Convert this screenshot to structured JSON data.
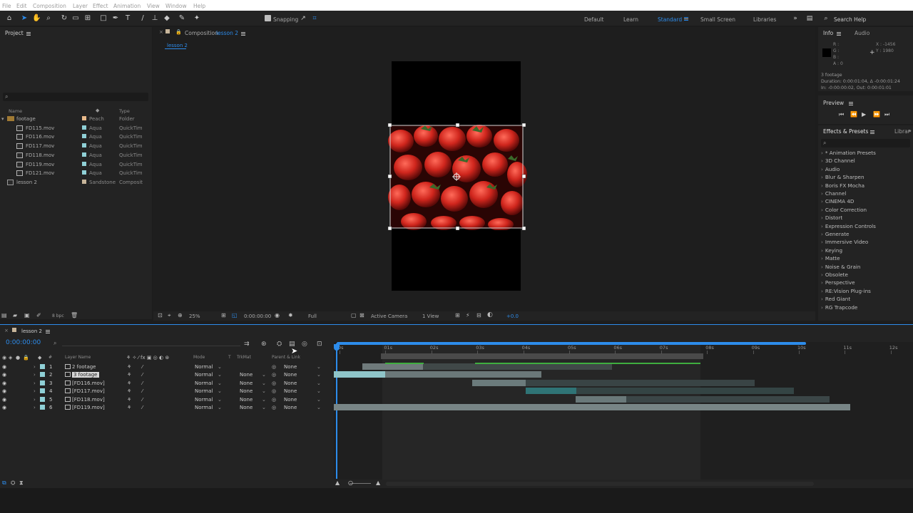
{
  "menu": [
    "File",
    "Edit",
    "Composition",
    "Layer",
    "Effect",
    "Animation",
    "View",
    "Window",
    "Help"
  ],
  "toolbar": {
    "snapping_label": "Snapping",
    "workspaces": [
      "Default",
      "Learn",
      "Standard",
      "Small Screen",
      "Libraries"
    ],
    "active_workspace": "Standard",
    "search_help": "Search Help"
  },
  "project": {
    "title": "Project",
    "col_name": "Name",
    "col_type": "Type",
    "items": [
      {
        "name": "footage",
        "label": "Peach",
        "type": "Folder",
        "color": "#e8b98a",
        "kind": "folder"
      },
      {
        "name": "FD115.mov",
        "label": "Aqua",
        "type": "QuickTim",
        "color": "#8fd0d6",
        "kind": "file"
      },
      {
        "name": "FD116.mov",
        "label": "Aqua",
        "type": "QuickTim",
        "color": "#8fd0d6",
        "kind": "file"
      },
      {
        "name": "FD117.mov",
        "label": "Aqua",
        "type": "QuickTim",
        "color": "#8fd0d6",
        "kind": "file"
      },
      {
        "name": "FD118.mov",
        "label": "Aqua",
        "type": "QuickTim",
        "color": "#8fd0d6",
        "kind": "file"
      },
      {
        "name": "FD119.mov",
        "label": "Aqua",
        "type": "QuickTim",
        "color": "#8fd0d6",
        "kind": "file"
      },
      {
        "name": "FD121.mov",
        "label": "Aqua",
        "type": "QuickTim",
        "color": "#8fd0d6",
        "kind": "file"
      },
      {
        "name": "lesson 2",
        "label": "Sandstone",
        "type": "Composit",
        "color": "#c7b59a",
        "kind": "comp"
      }
    ],
    "bpc": "8 bpc"
  },
  "composition": {
    "tab_prefix": "Composition",
    "tab_name": "lesson 2",
    "breadcrumb": "lesson 2",
    "zoom": "25%",
    "timecode": "0:00:00:00",
    "resolution": "Full",
    "camera": "Active Camera",
    "views": "1 View",
    "exposure": "+0.0"
  },
  "info": {
    "tab_info": "Info",
    "tab_audio": "Audio",
    "rgba": [
      "R :",
      "G :",
      "B :",
      "A : 0"
    ],
    "x": "X : -1456",
    "y": "Y : 1980",
    "sel_name": "3 footage",
    "duration": "Duration: 0:00:01:04, Δ -0:00:01:24",
    "inout": "In: -0:00:00:02, Out: 0:00:01:01"
  },
  "preview": {
    "title": "Preview"
  },
  "effects": {
    "tab": "Effects & Presets",
    "tab2": "Librar",
    "items": [
      "* Animation Presets",
      "3D Channel",
      "Audio",
      "Blur & Sharpen",
      "Boris FX Mocha",
      "Channel",
      "CINEMA 4D",
      "Color Correction",
      "Distort",
      "Expression Controls",
      "Generate",
      "Immersive Video",
      "Keying",
      "Matte",
      "Noise & Grain",
      "Obsolete",
      "Perspective",
      "RE:Vision Plug-ins",
      "Red Giant",
      "RG Trapcode"
    ]
  },
  "timeline": {
    "tab": "lesson 2",
    "timecode": "0:00:00:00",
    "col_layer": "Layer Name",
    "col_mode": "Mode",
    "col_t": "T",
    "col_trkmat": "TrkMat",
    "col_parent": "Parent & Link",
    "ruler": [
      "0s",
      "01s",
      "02s",
      "03s",
      "04s",
      "05s",
      "06s",
      "07s",
      "08s",
      "09s",
      "10s",
      "11s",
      "12s"
    ],
    "layers": [
      {
        "num": "1",
        "name": "2 footage",
        "mode": "Normal",
        "trkmat": "",
        "parent": "None",
        "selected": false
      },
      {
        "num": "2",
        "name": "3 footage",
        "mode": "Normal",
        "trkmat": "None",
        "parent": "None",
        "selected": true
      },
      {
        "num": "3",
        "name": "[FD116.mov]",
        "mode": "Normal",
        "trkmat": "None",
        "parent": "None",
        "selected": false
      },
      {
        "num": "4",
        "name": "[FD117.mov]",
        "mode": "Normal",
        "trkmat": "None",
        "parent": "None",
        "selected": false
      },
      {
        "num": "5",
        "name": "[FD118.mov]",
        "mode": "Normal",
        "trkmat": "None",
        "parent": "None",
        "selected": false
      },
      {
        "num": "6",
        "name": "[FD119.mov]",
        "mode": "Normal",
        "trkmat": "None",
        "parent": "None",
        "selected": false
      }
    ]
  },
  "colors": {
    "accent": "#2d8ceb",
    "aqua": "#8fd0d6"
  }
}
